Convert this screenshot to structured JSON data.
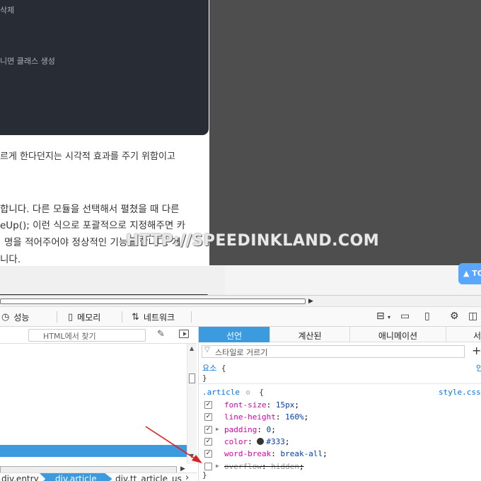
{
  "code_panel": {
    "line1": "삭제",
    "line2": "니면 클래스 생성"
  },
  "article": {
    "lines": [
      "르게 한다던지는 시각적 효과를 주기 위함이고",
      "합니다. 다른 모듈을 선택해서 펼쳤을 때 다른",
      "eUp(); 이런 식으로 포괄적으로 지정해주면 카",
      "명을 적어주어야 정상적인 기능을 합니다. 개",
      "니다."
    ]
  },
  "watermark": "HTTP://SPEEDINKLAND.COM",
  "top_button": {
    "icon": "up-triangle-icon",
    "label": "▲ TO"
  },
  "devtools": {
    "toolbar": {
      "tabs": [
        {
          "icon": "performance-icon",
          "label": "성능"
        },
        {
          "icon": "memory-icon",
          "label": "메모리"
        },
        {
          "icon": "network-icon",
          "label": "네트워크"
        }
      ]
    },
    "inspector": {
      "search_placeholder": "HTML에서 찾기",
      "breadcrumbs": [
        "div.entry",
        "div.article",
        "div.tt_article_usel"
      ]
    },
    "rules": {
      "tabs": [
        "선언",
        "계산된",
        "애니메이션",
        "서"
      ],
      "selected_tab": "선언",
      "filter_placeholder": "스타일로 거르기",
      "element_rule": {
        "selector": "요소",
        "open": "{",
        "close": "}",
        "right_label": "인"
      },
      "article_rule": {
        "selector": ".article",
        "open": "{",
        "source": "style.css",
        "close": "}",
        "declarations": [
          {
            "prop": "font-size",
            "value": "15px",
            "checked": true,
            "expandable": false,
            "enabled": true
          },
          {
            "prop": "line-height",
            "value": "160%",
            "checked": true,
            "expandable": false,
            "enabled": true
          },
          {
            "prop": "padding",
            "value": "0",
            "checked": true,
            "expandable": true,
            "enabled": true
          },
          {
            "prop": "color",
            "value": "#333",
            "checked": true,
            "expandable": false,
            "enabled": true,
            "swatch": "#333333"
          },
          {
            "prop": "word-break",
            "value": "break-all",
            "checked": true,
            "expandable": false,
            "enabled": true
          },
          {
            "prop": "overflow",
            "value": "hidden",
            "checked": false,
            "expandable": true,
            "enabled": false
          }
        ]
      }
    }
  },
  "colors": {
    "accent": "#3c9ade",
    "annotation_arrow": "#e02020",
    "code_bg": "#282c34"
  }
}
